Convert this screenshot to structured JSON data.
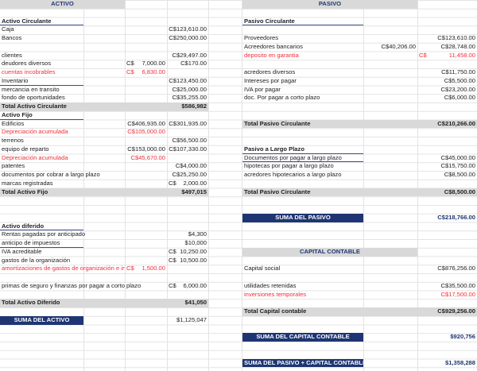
{
  "left": [
    {
      "type": "header",
      "label": "ACTIVO"
    },
    null,
    {
      "type": "section",
      "label": "Activo Circulante"
    },
    {
      "label": "Caja",
      "amount": "C$123,610.00"
    },
    {
      "label": "Bancos",
      "amount": "C$250,000.00"
    },
    null,
    {
      "label": "clientes",
      "amount": "C$29,497.00"
    },
    {
      "label": "deudores diversos",
      "sub_cur": "C$",
      "sub": "7,000.00",
      "amount": "C$170.00"
    },
    {
      "label": "cuentas incobrables",
      "red": true,
      "sub_cur": "C$",
      "sub": "6,830.00"
    },
    {
      "label": "Inventario",
      "underline": true,
      "amount": "C$123,450.00"
    },
    {
      "label": "mercancia en transito",
      "amount": "C$25,000.00"
    },
    {
      "label": "fondo de oportunidades",
      "amount": "C$35,255.00"
    },
    {
      "type": "total",
      "label": "Total Activo Circulante",
      "amount": "$586,982"
    },
    {
      "type": "section",
      "label": "Activo Fijo"
    },
    {
      "label": "Edificios",
      "sub": "C$406,935.00",
      "amount": "C$301,935.00"
    },
    {
      "label": "Depreciación acumulada",
      "red": true,
      "sub": "C$105,000.00"
    },
    {
      "label": "terrenos",
      "amount": "C$56,500.00"
    },
    {
      "label": "equipo de reparto",
      "sub": "C$153,000.00",
      "amount": "C$107,330.00"
    },
    {
      "label": "Depreciación acumulada",
      "red": true,
      "sub": "C$45,670.00"
    },
    {
      "label": "patentes",
      "amount": "C$4,000.00"
    },
    {
      "label": "documentos por cobrar a largo plazo",
      "amount": "C$25,250.00"
    },
    {
      "label": "marcas registradas",
      "amount_cur": "C$",
      "amount": "2,000.00"
    },
    {
      "type": "total",
      "label": "Total Activo Fijo",
      "amount": "$497,015"
    },
    null,
    null,
    null,
    {
      "type": "section",
      "label": "Activo diferido"
    },
    {
      "label": "Rentas pagadas por anticipado",
      "amount": "$4,300"
    },
    {
      "label": "anticipo de impuestos",
      "underline": true,
      "amount": "$10,000"
    },
    {
      "label": "IVA acreditable",
      "amount_cur": "C$",
      "amount": "10,250.00"
    },
    {
      "label": "gastos de la organización",
      "amount_cur": "C$",
      "amount": "10,500.00"
    },
    {
      "label": "amortizaciones de gastos de organización e instalación",
      "red": true,
      "sub_cur": "C$",
      "sub": "1,500.00"
    },
    null,
    {
      "label": "primas de seguro y finanzas  por pagar a corto plazo",
      "amount_cur": "C$",
      "amount": "6,000.00"
    },
    null,
    {
      "type": "total",
      "label": "Total Activo Diferido",
      "amount": "$41,050"
    },
    null,
    {
      "type": "band",
      "label": "SUMA DEL ACTIVO",
      "amount": "$1,125,047"
    }
  ],
  "right": [
    {
      "type": "header",
      "label": "PASIVO"
    },
    null,
    {
      "type": "section",
      "label": "Pasivo Circulante"
    },
    null,
    {
      "label": "Proveedores",
      "amount": "C$123,610.00"
    },
    {
      "label": "Acreedores bancarios",
      "sub": "C$40,206.00",
      "amount": "C$28,748.00"
    },
    {
      "label": "deposito en garantia",
      "red": true,
      "amount_cur": "C$",
      "amount": "11,458.00"
    },
    null,
    {
      "label": "acredores diversos",
      "amount": "C$11,750.00"
    },
    {
      "label": "Intereses por pagar",
      "amount": "C$5,500.00"
    },
    {
      "label": "IVA por pagar",
      "amount": "C$23,200.00"
    },
    {
      "label": "doc. Por pagar a corto plazo",
      "amount": "C$6,000.00"
    },
    null,
    null,
    {
      "type": "total",
      "label": "Total Pasivo Circulante",
      "amount": "C$210,266.00"
    },
    null,
    null,
    {
      "type": "section",
      "label": "Pasivo a Largo Plazo"
    },
    {
      "label": "Documentos por pagar a largo plazo",
      "underline": true,
      "amount": "C$45,000.00"
    },
    {
      "label": "hipotecas por pagar a largo plazo",
      "amount": "C$15,750.00"
    },
    {
      "label": "acredores hipotecarios a largo plazo",
      "amount": "C$8,500.00"
    },
    null,
    {
      "type": "total",
      "label": "Total Pasivo Circulante",
      "amount": "C$8,500.00"
    },
    null,
    null,
    {
      "type": "band",
      "label": "SUMA DEL PASIVO",
      "amount": "C$218,766.00"
    },
    null,
    null,
    null,
    {
      "type": "header",
      "label": "CAPITAL CONTABLE"
    },
    null,
    {
      "label": "Capital social",
      "amount": "C$876,256.00"
    },
    null,
    {
      "label": "utilidades retenidas",
      "amount": "C$35,500.00"
    },
    {
      "label": "inversiones temporales",
      "red": true,
      "amount": "C$17,500.00"
    },
    null,
    {
      "type": "total",
      "label": "Total Capital contable",
      "amount": "C$929,256.00"
    },
    null,
    null,
    {
      "type": "band",
      "label": "SUMA DEL CAPITAL CONTABLE",
      "amount": "$920,756"
    },
    null,
    null,
    {
      "type": "band",
      "label": "SUMA DEL PASIVO + CAPITAL CONTABLE",
      "amount": "$1,358,288"
    }
  ]
}
